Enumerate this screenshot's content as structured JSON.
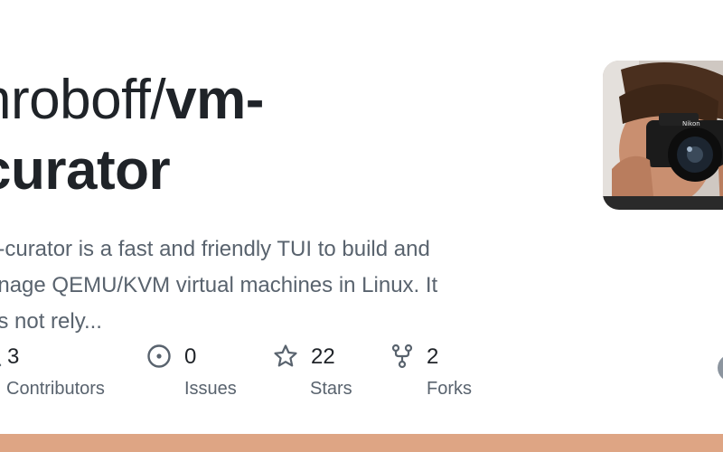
{
  "repo": {
    "owner": "nroboff",
    "slash": "/",
    "name_line1": "vm-",
    "name_line2": "curator"
  },
  "description": {
    "line1": "n-curator is a fast and friendly TUI to build and",
    "line2": "anage QEMU/KVM virtual machines in Linux. It",
    "line3": "es not rely..."
  },
  "stats": {
    "contributors": {
      "count": "3",
      "label": "Contributors",
      "icon": "people-icon"
    },
    "issues": {
      "count": "0",
      "label": "Issues",
      "icon": "issue-icon"
    },
    "stars": {
      "count": "22",
      "label": "Stars",
      "icon": "star-icon"
    },
    "forks": {
      "count": "2",
      "label": "Forks",
      "icon": "fork-icon"
    }
  },
  "avatar": {
    "alt_icon": "photographer-avatar"
  },
  "colors": {
    "language_bar": "#dea584",
    "text_primary": "#1f2328",
    "text_muted": "#59636e"
  }
}
